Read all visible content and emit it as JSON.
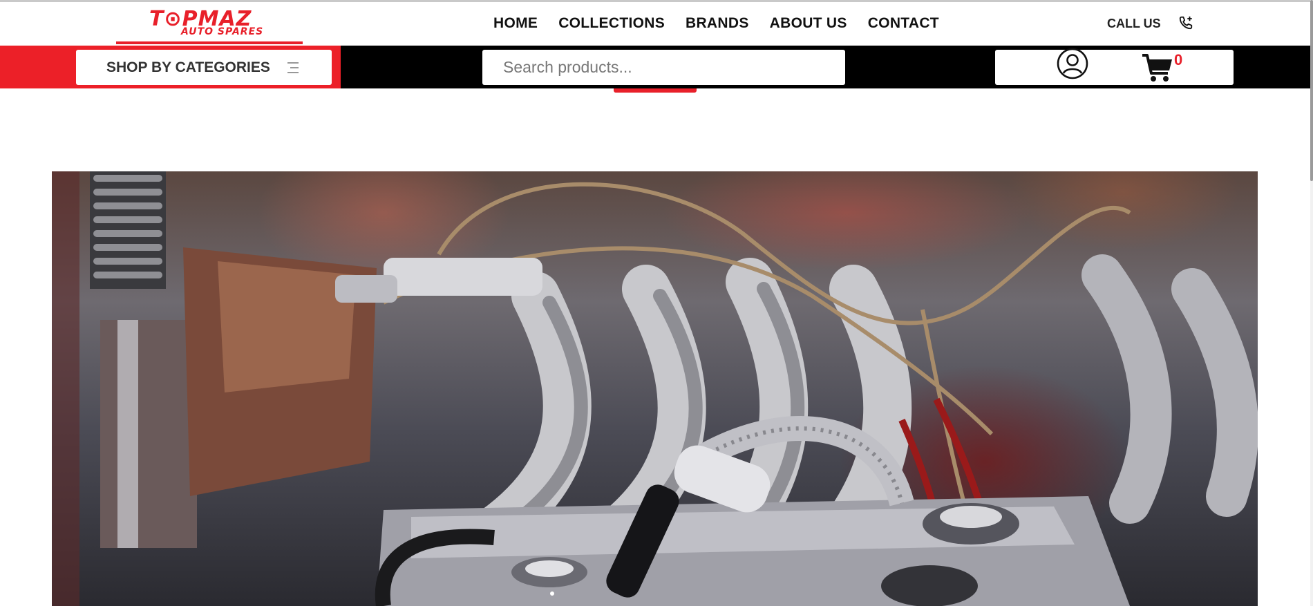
{
  "header": {
    "logo_main": "T⊙PMAZ",
    "logo_sub": "AUTO SPARES",
    "nav": [
      "HOME",
      "COLLECTIONS",
      "BRANDS",
      "ABOUT US",
      "CONTACT"
    ],
    "call_label": "CALL US",
    "phone_icon": "phone-plus-icon"
  },
  "toolbar": {
    "categories_label": "SHOP BY CATEGORIES",
    "categories_icon": "menu-icon",
    "search_placeholder": "Search products...",
    "user_icon": "user-circle-icon",
    "cart_icon": "shopping-cart-icon",
    "cart_count": "0"
  },
  "colors": {
    "accent": "#e8202a",
    "bar": "#000000",
    "text": "#111111"
  },
  "hero": {
    "image": "engine-bay-chrome-photo"
  }
}
